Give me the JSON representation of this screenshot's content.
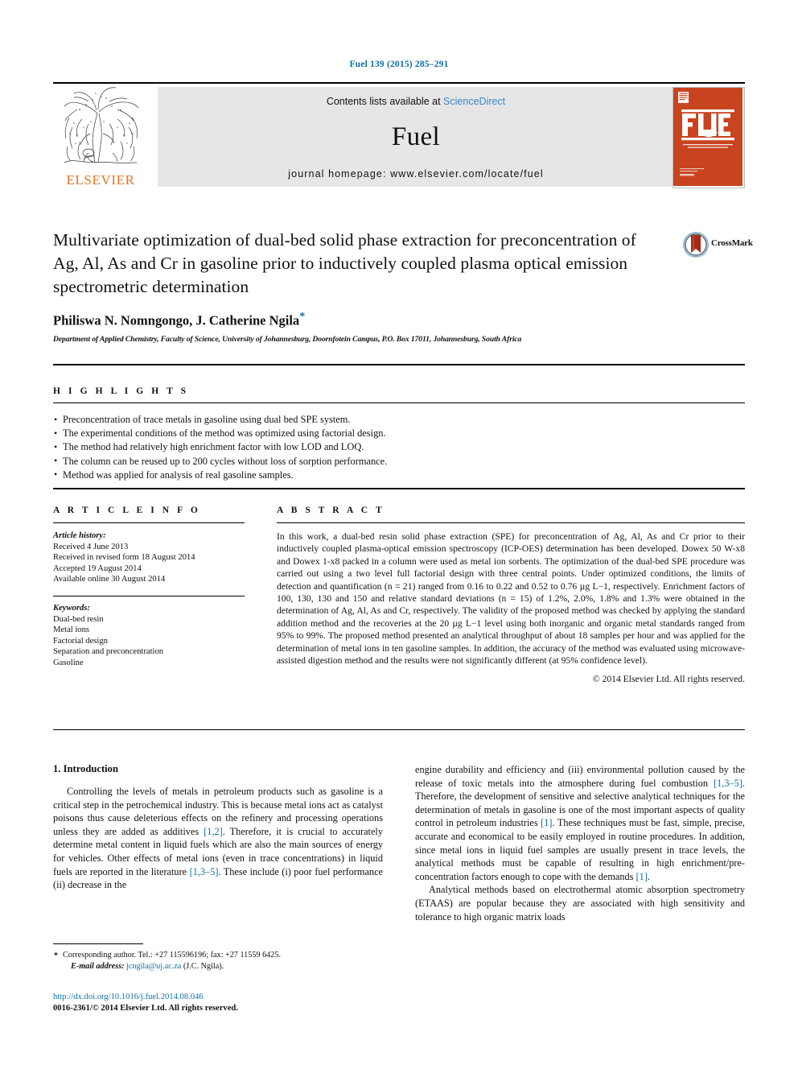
{
  "running_head": "Fuel 139 (2015) 285–291",
  "masthead": {
    "publisher_name": "ELSEVIER",
    "contents_prefix": "Contents lists available at ",
    "contents_link": "ScienceDirect",
    "journal_title": "Fuel",
    "homepage": "journal homepage: www.elsevier.com/locate/fuel",
    "cover_journal": "FUEL",
    "cover_tagline": "The science and technology of fuel and energy"
  },
  "article": {
    "title": "Multivariate optimization of dual-bed solid phase extraction for preconcentration of Ag, Al, As and Cr in gasoline prior to inductively coupled plasma optical emission spectrometric determination",
    "authors": "Philiswa N. Nomngongo, J. Catherine Ngila",
    "corresponding_marker": "*",
    "affiliation": "Department of Applied Chemistry, Faculty of Science, University of Johannesburg, Doornfotein Campus, P.O. Box 17011, Johannesburg, South Africa",
    "crossmark_label": "CrossMark"
  },
  "highlights": {
    "heading": "H I G H L I G H T S",
    "items": [
      "Preconcentration of trace metals in gasoline using dual bed SPE system.",
      "The experimental conditions of the method was optimized using factorial design.",
      "The method had relatively high enrichment factor with low LOD and LOQ.",
      "The column can be reused up to 200 cycles without loss of sorption performance.",
      "Method was applied for analysis of real gasoline samples."
    ]
  },
  "article_info": {
    "heading": "A R T I C L E    I N F O",
    "history_label": "Article history:",
    "history": [
      "Received 4 June 2013",
      "Received in revised form 18 August 2014",
      "Accepted 19 August 2014",
      "Available online 30 August 2014"
    ],
    "keywords_label": "Keywords:",
    "keywords": [
      "Dual-bed resin",
      "Metal ions",
      "Factorial design",
      "Separation and preconcentration",
      "Gasoline"
    ]
  },
  "abstract": {
    "heading": "A B S T R A C T",
    "text": "In this work, a dual-bed resin solid phase extraction (SPE) for preconcentration of Ag, Al, As and Cr prior to their inductively coupled plasma-optical emission spectroscopy (ICP-OES) determination has been developed. Dowex 50 W-x8 and Dowex 1-x8 packed in a column were used as metal ion sorbents. The optimization of the dual-bed SPE procedure was carried out using a two level full factorial design with three central points. Under optimized conditions, the limits of detection and quantification (n = 21) ranged from 0.16 to 0.22 and 0.52 to 0.76 µg L−1, respectively. Enrichment factors of 100, 130, 130 and 150 and relative standard deviations (n = 15) of 1.2%, 2.0%, 1.8% and 1.3% were obtained in the determination of Ag, Al, As and Cr, respectively. The validity of the proposed method was checked by applying the standard addition method and the recoveries at the 20 µg L−1 level using both inorganic and organic metal standards ranged from 95% to 99%. The proposed method presented an analytical throughput of about 18 samples per hour and was applied for the determination of metal ions in ten gasoline samples. In addition, the accuracy of the method was evaluated using microwave-assisted digestion method and the results were not significantly different (at 95% confidence level).",
    "copyright": "© 2014 Elsevier Ltd. All rights reserved."
  },
  "introduction": {
    "section_title": "1. Introduction",
    "left_para_1_a": "Controlling the levels of metals in petroleum products such as gasoline is a critical step in the petrochemical industry. This is because metal ions act as catalyst poisons thus cause deleterious effects on the refinery and processing operations unless they are added as additives ",
    "left_ref_1": "[1,2]",
    "left_para_1_b": ". Therefore, it is crucial to accurately determine metal content in liquid fuels which are also the main sources of energy for vehicles. Other effects of metal ions (even in trace concentrations) in liquid fuels are reported in the literature ",
    "left_ref_2": "[1,3–5]",
    "left_para_1_c": ". These include (i) poor fuel performance (ii) decrease in the",
    "right_para_1_a": "engine durability and efficiency and (iii) environmental pollution caused by the release of toxic metals into the atmosphere during fuel combustion ",
    "right_ref_1": "[1,3–5]",
    "right_para_1_b": ". Therefore, the development of sensitive and selective analytical techniques for the determination of metals in gasoline is one of the most important aspects of quality control in petroleum industries ",
    "right_ref_2": "[1]",
    "right_para_1_c": ". These techniques must be fast, simple, precise, accurate and economical to be easily employed in routine procedures. In addition, since metal ions in liquid fuel samples are usually present in trace levels, the analytical methods must be capable of resulting in high enrichment/pre-concentration factors enough to cope with the demands ",
    "right_ref_3": "[1]",
    "right_para_1_d": ".",
    "right_para_2": "Analytical methods based on electrothermal atomic absorption spectrometry (ETAAS) are popular because they are associated with high sensitivity and tolerance to high organic matrix loads"
  },
  "footnote": {
    "star": "*",
    "corresponding": "Corresponding author. Tel.: +27 115596196; fax: +27 11559 6425.",
    "email_label": "E-mail address:",
    "email": "jcngila@uj.ac.za",
    "email_owner": "(J.C. Ngila)."
  },
  "imprint": {
    "doi": "http://dx.doi.org/10.1016/j.fuel.2014.08.046",
    "issn_line": "0016-2361/© 2014 Elsevier Ltd. All rights reserved."
  },
  "colors": {
    "link_blue": "#0b6ea8",
    "sciencedirect_blue": "#3a86c8",
    "elsevier_orange": "#e87422",
    "cover_orange": "#c8441f",
    "band_grey": "#e6e6e6"
  }
}
